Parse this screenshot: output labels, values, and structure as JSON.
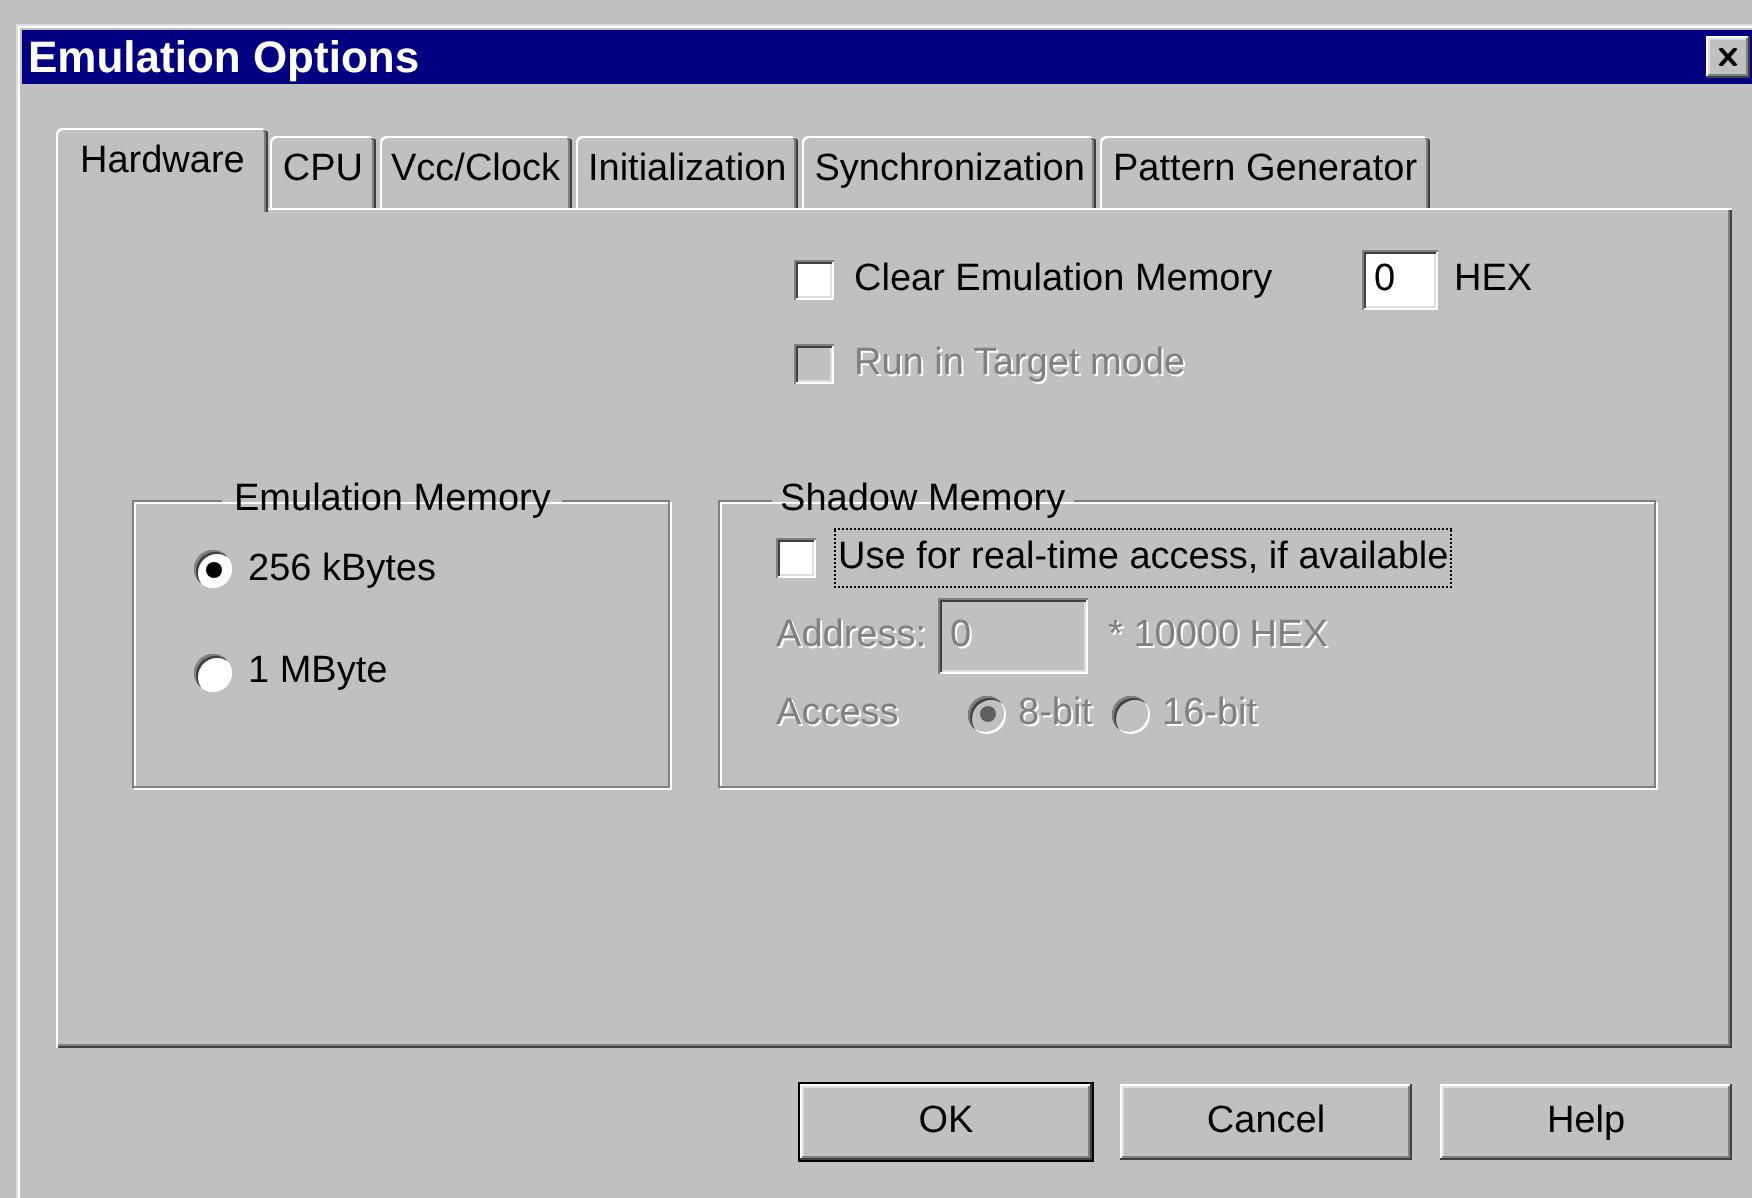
{
  "window": {
    "title": "Emulation Options"
  },
  "tabs": [
    {
      "label": "Hardware",
      "selected": true
    },
    {
      "label": "CPU",
      "selected": false
    },
    {
      "label": "Vcc/Clock",
      "selected": false
    },
    {
      "label": "Initialization",
      "selected": false
    },
    {
      "label": "Synchronization",
      "selected": false
    },
    {
      "label": "Pattern Generator",
      "selected": false
    }
  ],
  "clear_memory": {
    "label": "Clear Emulation Memory",
    "checked": false,
    "disabled": false,
    "value": "0",
    "unit": "HEX"
  },
  "run_in_target": {
    "label": "Run in Target mode",
    "checked": false,
    "disabled": true
  },
  "emulation_memory": {
    "title": "Emulation Memory",
    "options": [
      {
        "label": "256 kBytes",
        "selected": true
      },
      {
        "label": "1 MByte",
        "selected": false
      }
    ]
  },
  "shadow_memory": {
    "title": "Shadow Memory",
    "use": {
      "label": "Use for real-time access, if available",
      "checked": false,
      "focused": true
    },
    "address": {
      "label": "Address:",
      "value": "0",
      "unit": "* 10000 HEX",
      "disabled": true
    },
    "access": {
      "label": "Access",
      "disabled": true,
      "options": [
        {
          "label": "8-bit",
          "selected": true
        },
        {
          "label": "16-bit",
          "selected": false
        }
      ]
    }
  },
  "buttons": [
    {
      "label": "OK",
      "default": true
    },
    {
      "label": "Cancel",
      "default": false
    },
    {
      "label": "Help",
      "default": false
    }
  ]
}
